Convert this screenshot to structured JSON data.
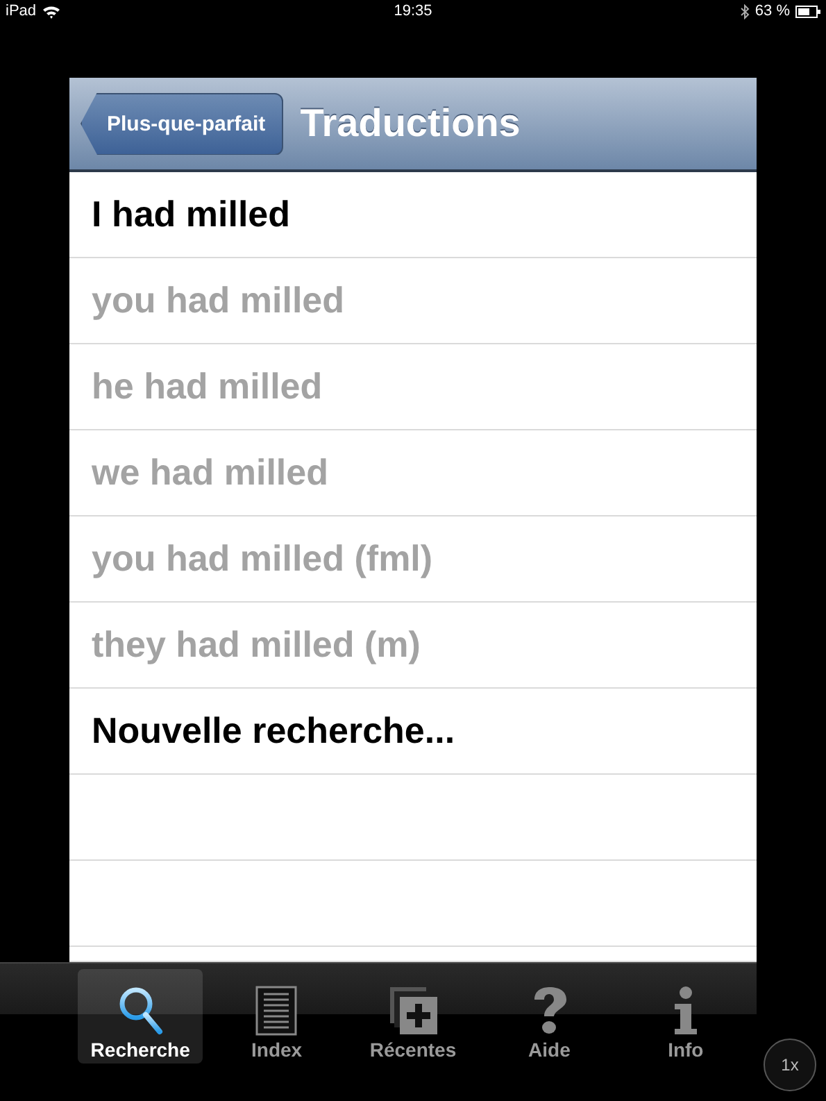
{
  "status_bar": {
    "device": "iPad",
    "time": "19:35",
    "battery": "63 %"
  },
  "nav_bar": {
    "back_button": "Plus-que-parfait",
    "title": "Traductions"
  },
  "rows": [
    {
      "label": "I had milled",
      "dimmed": false
    },
    {
      "label": "you had milled",
      "dimmed": true
    },
    {
      "label": "he had milled",
      "dimmed": true
    },
    {
      "label": "we had milled",
      "dimmed": true
    },
    {
      "label": "you had milled (fml)",
      "dimmed": true
    },
    {
      "label": "they had milled (m)",
      "dimmed": true
    },
    {
      "label": "Nouvelle recherche...",
      "dimmed": false
    }
  ],
  "tab_bar": [
    {
      "label": "Recherche",
      "kind": "search",
      "selected": true
    },
    {
      "label": "Index",
      "kind": "index",
      "selected": false
    },
    {
      "label": "Récentes",
      "kind": "recent",
      "selected": false
    },
    {
      "label": "Aide",
      "kind": "help",
      "selected": false
    },
    {
      "label": "Info",
      "kind": "info",
      "selected": false
    }
  ],
  "zoom_button": "1x"
}
